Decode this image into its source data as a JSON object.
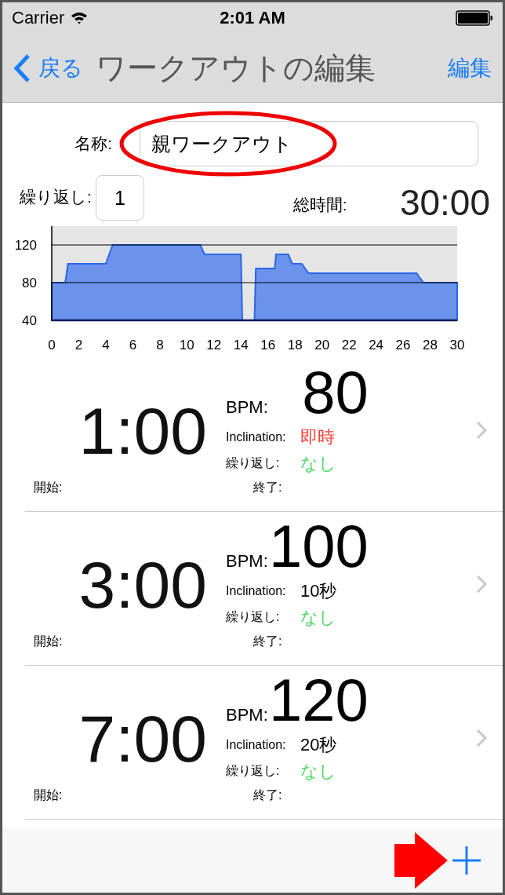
{
  "status_bar": {
    "carrier": "Carrier",
    "time": "2:01 AM"
  },
  "nav_bar": {
    "back": "戻る",
    "title": "ワークアウトの編集",
    "action": "編集"
  },
  "name_field": {
    "label": "名称:",
    "value": "親ワークアウト"
  },
  "repeat_field": {
    "label": "繰り返し:",
    "value": "1"
  },
  "total_time": {
    "label": "総時間:",
    "value": "30:00"
  },
  "chart_data": {
    "type": "area",
    "x": [
      0,
      1,
      1.2,
      4,
      4.5,
      11,
      11.3,
      14,
      14.1,
      15,
      15.1,
      16.5,
      16.6,
      17.5,
      17.8,
      18.5,
      19,
      27,
      27.5,
      30
    ],
    "series": [
      {
        "color": "#6b93ec",
        "values": [
          80,
          80,
          100,
          100,
          120,
          120,
          110,
          110,
          40,
          40,
          95,
          95,
          110,
          110,
          100,
          100,
          90,
          90,
          80,
          80
        ]
      }
    ],
    "xlim": [
      0,
      30
    ],
    "ylim": [
      40,
      140
    ],
    "xticks": [
      0,
      2,
      4,
      6,
      8,
      10,
      12,
      14,
      16,
      18,
      20,
      22,
      24,
      26,
      28,
      30
    ],
    "yticks": [
      40,
      80,
      120
    ]
  },
  "intervals": [
    {
      "duration": "1:00",
      "bpm_label": "BPM:",
      "bpm": "80",
      "inclination_label": "Inclination:",
      "inclination": {
        "text": "即時",
        "color": "#ff3b30"
      },
      "repeat_label": "繰り返し:",
      "repeat": "なし",
      "start_label": "開始:",
      "end_label": "終了:"
    },
    {
      "duration": "3:00",
      "bpm_label": "BPM:",
      "bpm": "100",
      "inclination_label": "Inclination:",
      "inclination": {
        "text": "10秒",
        "color": "#000000"
      },
      "repeat_label": "繰り返し:",
      "repeat": "なし",
      "start_label": "開始:",
      "end_label": "終了:"
    },
    {
      "duration": "7:00",
      "bpm_label": "BPM:",
      "bpm": "120",
      "inclination_label": "Inclination:",
      "inclination": {
        "text": "20秒",
        "color": "#000000"
      },
      "repeat_label": "繰り返し:",
      "repeat": "なし",
      "start_label": "開始:",
      "end_label": "終了:"
    }
  ]
}
